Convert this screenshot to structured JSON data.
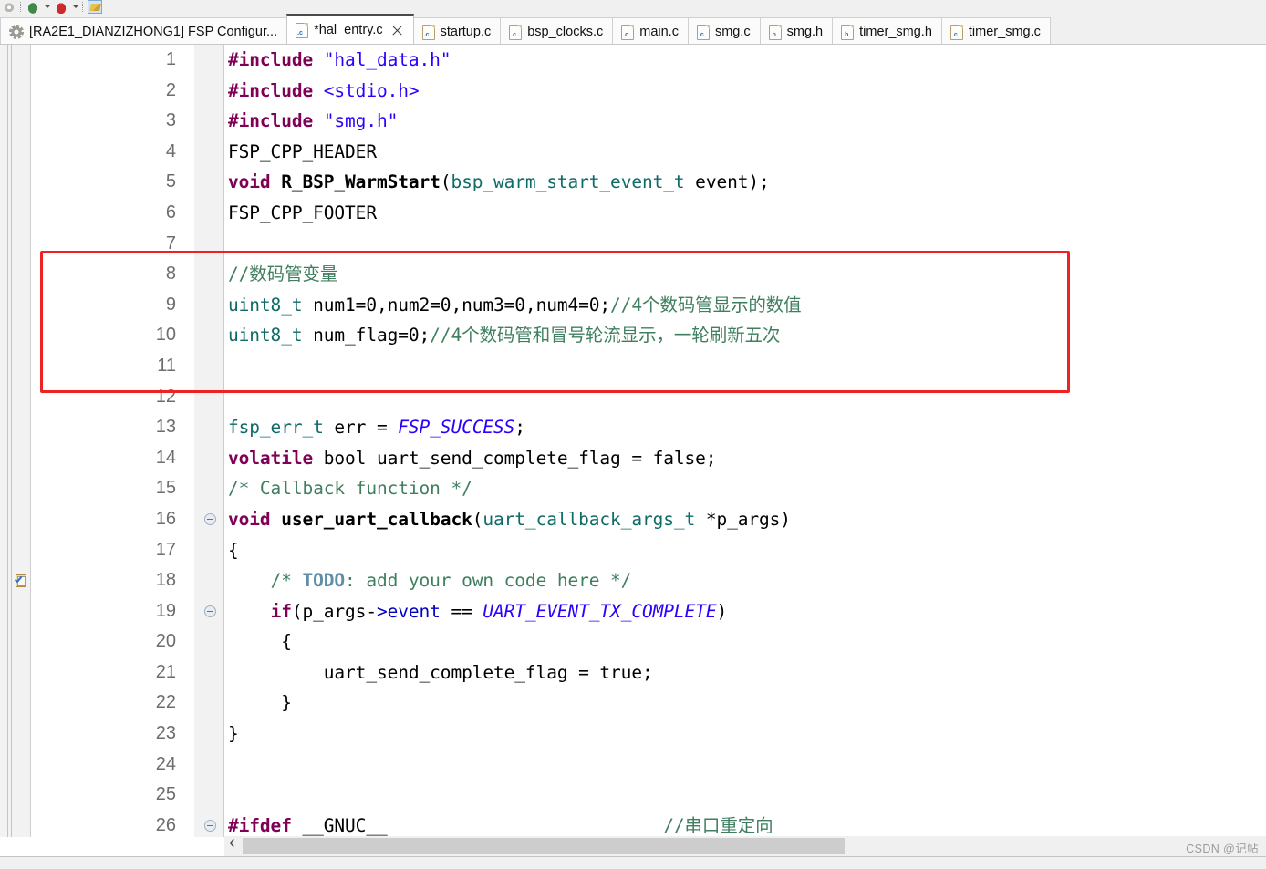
{
  "toolbar": {
    "icons": [
      "gear-icon",
      "debug-bug-icon",
      "run-icon",
      "highlighter-icon"
    ]
  },
  "tabs": [
    {
      "label": "[RA2E1_DIANZIZHONG1] FSP Configur...",
      "icon": "gear-icon",
      "active": false,
      "closable": false
    },
    {
      "label": "*hal_entry.c",
      "icon": "c-file-icon",
      "icon_letter": ".c",
      "active": true,
      "closable": true
    },
    {
      "label": "startup.c",
      "icon": "c-file-icon",
      "icon_letter": ".c",
      "active": false,
      "closable": false
    },
    {
      "label": "bsp_clocks.c",
      "icon": "c-file-icon",
      "icon_letter": ".c",
      "active": false,
      "closable": false
    },
    {
      "label": "main.c",
      "icon": "c-file-icon",
      "icon_letter": ".c",
      "active": false,
      "closable": false
    },
    {
      "label": "smg.c",
      "icon": "c-file-icon",
      "icon_letter": ".c",
      "active": false,
      "closable": false
    },
    {
      "label": "smg.h",
      "icon": "h-file-icon",
      "icon_letter": ".h",
      "active": false,
      "closable": false
    },
    {
      "label": "timer_smg.h",
      "icon": "h-file-icon",
      "icon_letter": ".h",
      "active": false,
      "closable": false
    },
    {
      "label": "timer_smg.c",
      "icon": "c-file-icon",
      "icon_letter": ".c",
      "active": false,
      "closable": false
    }
  ],
  "editor": {
    "lines": [
      {
        "n": "1",
        "fold": false
      },
      {
        "n": "2",
        "fold": false
      },
      {
        "n": "3",
        "fold": false
      },
      {
        "n": "4",
        "fold": false
      },
      {
        "n": "5",
        "fold": false
      },
      {
        "n": "6",
        "fold": false
      },
      {
        "n": "7",
        "fold": false
      },
      {
        "n": "8",
        "fold": false
      },
      {
        "n": "9",
        "fold": false
      },
      {
        "n": "10",
        "fold": false
      },
      {
        "n": "11",
        "fold": false
      },
      {
        "n": "12",
        "fold": false
      },
      {
        "n": "13",
        "fold": false
      },
      {
        "n": "14",
        "fold": false
      },
      {
        "n": "15",
        "fold": false
      },
      {
        "n": "16",
        "fold": true
      },
      {
        "n": "17",
        "fold": false
      },
      {
        "n": "18",
        "fold": false
      },
      {
        "n": "19",
        "fold": true
      },
      {
        "n": "20",
        "fold": false
      },
      {
        "n": "21",
        "fold": false
      },
      {
        "n": "22",
        "fold": false
      },
      {
        "n": "23",
        "fold": false
      },
      {
        "n": "24",
        "fold": false
      },
      {
        "n": "25",
        "fold": false
      },
      {
        "n": "26",
        "fold": true
      }
    ],
    "code_text": {
      "l1": "#include \"hal_data.h\"",
      "l2": "#include <stdio.h>",
      "l3": "#include \"smg.h\"",
      "l4": "FSP_CPP_HEADER",
      "l5": "void R_BSP_WarmStart(bsp_warm_start_event_t event);",
      "l6": "FSP_CPP_FOOTER",
      "l7": "",
      "l8": "//数码管变量",
      "l9": "uint8_t num1=0,num2=0,num3=0,num4=0;//4个数码管显示的数值",
      "l10": "uint8_t num_flag=0;//4个数码管和冒号轮流显示，一轮刷新五次",
      "l11": "",
      "l12": "",
      "l13": "fsp_err_t err = FSP_SUCCESS;",
      "l14": "volatile bool uart_send_complete_flag = false;",
      "l15": "/* Callback function */",
      "l16": "void user_uart_callback(uart_callback_args_t *p_args)",
      "l17": "{",
      "l18": "    /* TODO: add your own code here */",
      "l19": "    if(p_args->event == UART_EVENT_TX_COMPLETE)",
      "l20": "     {",
      "l21": "         uart_send_complete_flag = true;",
      "l22": "     }",
      "l23": "}",
      "l24": "",
      "l25": "",
      "l26": "#ifdef __GNUC__                          //串口重定向"
    },
    "tokens": {
      "include": "#include",
      "hal_data_h": "\"hal_data.h\"",
      "stdio_h": "<stdio.h>",
      "smg_h": "\"smg.h\"",
      "fsp_cpp_header": "FSP_CPP_HEADER",
      "kw_void": "void",
      "fn_warmstart": "R_BSP_WarmStart",
      "type_bsp_warm": "bsp_warm_start_event_t",
      "arg_event": " event);",
      "paren_open": "(",
      "fsp_cpp_footer": "FSP_CPP_FOOTER",
      "cmt_smg_var": "//数码管变量",
      "type_uint8": "uint8_t",
      "decl_nums": " num1=0,num2=0,num3=0,num4=0;",
      "cmt_nums": "//4个数码管显示的数值",
      "decl_numflag": " num_flag=0;",
      "cmt_numflag": "//4个数码管和冒号轮流显示，一轮刷新五次",
      "type_fsp_err": "fsp_err_t",
      "err_assign": " err = ",
      "const_fsp_success": "FSP_SUCCESS",
      "semi": ";",
      "kw_volatile": "volatile",
      "bool_decl": " bool uart_send_complete_flag = false;",
      "cmt_callback": "/* Callback function */",
      "fn_callback": "user_uart_callback",
      "callback_args": "uart_callback_args_t",
      "callback_tail": " *p_args)",
      "brace_open": "{",
      "cmt_todo_open": "/* ",
      "todo_word": "TODO",
      "cmt_todo_rest": ": add your own code here */",
      "kw_if": "if",
      "if_pargs": "(p_args-",
      "arrow_event": ">event",
      "eq_eq": " == ",
      "const_uart_evt": "UART_EVENT_TX_COMPLETE",
      "paren_close": ")",
      "inner_brace_open": "     {",
      "flag_true": "         uart_send_complete_flag = true;",
      "inner_brace_close": "     }",
      "brace_close": "}",
      "pp_ifdef": "#ifdef",
      "gnuc": " __GNUC__",
      "cmt_uart_redirect": "//串口重定向"
    }
  },
  "annotation": {
    "redbox_label": "highlight-box-around-lines-8-to-11",
    "color": "#ee2222"
  },
  "scrollbar": {
    "left_arrow": "‹"
  },
  "watermark": {
    "text": "CSDN @记帖"
  },
  "colors": {
    "keyword": "#7f0055",
    "string": "#2a00ff",
    "type": "#0f6b68",
    "comment": "#3f7f5f",
    "constant": "#2a00ff",
    "todo": "#5f8fa8",
    "linenumber": "#6d6d6d",
    "accent_red": "#ee2222"
  }
}
